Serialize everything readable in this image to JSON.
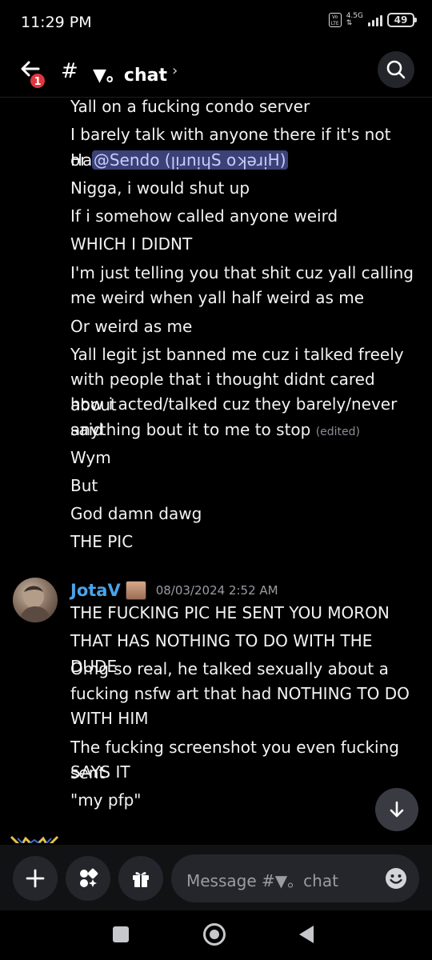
{
  "status_bar": {
    "time": "11:29 PM",
    "volte_label": "Vo LTE",
    "network": "4.5G",
    "battery": "49"
  },
  "header": {
    "back_icon": "arrow-left-icon",
    "mention_badge": "1",
    "hash": "#",
    "channel_name": "▼。chat",
    "chevron": "›",
    "search_icon": "search-icon"
  },
  "messages": {
    "continuation": [
      "Yall on a fucking condo server",
      "I barely talk with anyone there if it's not Haze",
      "Nigga, i would shut up",
      "If i somehow called anyone weird",
      "WHICH I DIDNT",
      "I'm just telling you that shit cuz yall calling",
      "me weird when yall half weird as me",
      "Or weird as me",
      "Yall legit jst banned me cuz i talked freely",
      "with people that i thought didnt cared about",
      "how i acted/talked cuz they barely/never said",
      "anything bout it to me to stop",
      "Wym",
      "But",
      "God damn dawg",
      "THE PIC"
    ],
    "or_prefix": "or",
    "mention": "@Sendo (ꞁᴉɹnᴉɥS oʞǝɹᴉH)",
    "edited": "(edited)",
    "group": {
      "author": "JotaV",
      "timestamp": "08/03/2024 2:52 AM",
      "lines": [
        "THE FUCKING PIC HE SENT YOU MORON",
        "THAT HAS NOTHING TO DO WITH THE DUDE",
        "Omg so real, he talked sexually about a",
        "fucking nsfw art that had NOTHING TO DO",
        "WITH HIM",
        "The fucking screenshot you even fucking sent",
        "SAYS IT",
        "\"my pfp\""
      ]
    }
  },
  "input_bar": {
    "placeholder": "Message #▼。chat",
    "add_icon": "plus-icon",
    "apps_icon": "apps-icon",
    "gift_icon": "gift-icon",
    "emoji_icon": "emoji-icon"
  },
  "colors": {
    "background": "#000000",
    "username": "#4ba3e8",
    "mention_bg": "#3b4277",
    "badge": "#e0363f"
  }
}
